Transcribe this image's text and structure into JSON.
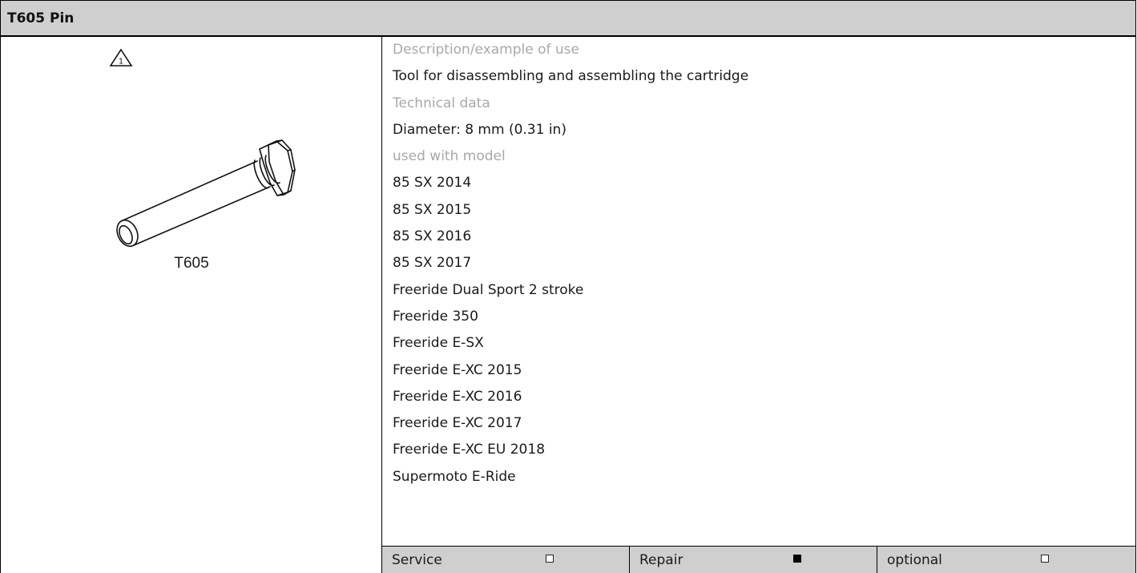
{
  "header": {
    "title": "T605 Pin"
  },
  "figure": {
    "warning_number": "1",
    "tool_code": "T605"
  },
  "details": {
    "description_label": "Description/example of use",
    "description_value": "Tool for disassembling and assembling the cartridge",
    "technical_label": "Technical data",
    "technical_value": "Diameter: 8 mm (0.31 in)",
    "models_label": "used with model",
    "models": [
      "85 SX 2014",
      "85 SX 2015",
      "85 SX 2016",
      "85 SX 2017",
      "Freeride Dual Sport 2 stroke",
      "Freeride 350",
      "Freeride E-SX",
      "Freeride E-XC 2015",
      "Freeride E-XC 2016",
      "Freeride E-XC 2017",
      "Freeride E-XC EU 2018",
      "Supermoto E-Ride"
    ]
  },
  "footer": {
    "items": [
      {
        "label": "Service",
        "checked": false
      },
      {
        "label": "Repair",
        "checked": true
      },
      {
        "label": "optional",
        "checked": false
      }
    ]
  }
}
